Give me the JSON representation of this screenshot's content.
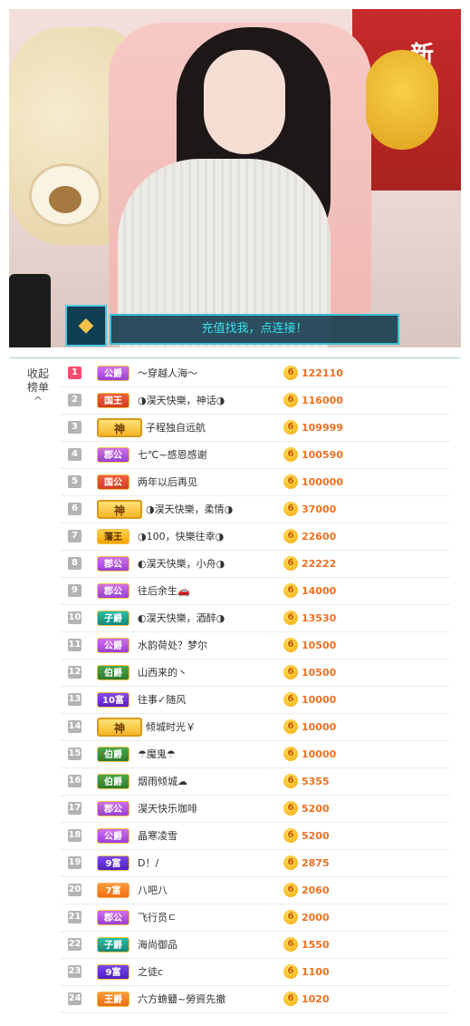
{
  "stream": {
    "banner_text": "充值找我，点连接！",
    "badge_icon": "diamond-icon",
    "background_text": "新"
  },
  "side": {
    "line1": "收起",
    "line2": "榜单",
    "chevron": "^"
  },
  "coin_glyph": "6",
  "leaderboard": [
    {
      "rank": "1",
      "title": "公爵",
      "style": "gong",
      "name": "～穿越人海～",
      "score": "122110"
    },
    {
      "rank": "2",
      "title": "国王",
      "style": "guowang",
      "name": "◑淏天快樂，神话◑",
      "score": "116000"
    },
    {
      "rank": "3",
      "title": "神",
      "style": "shen",
      "name": "子程独自远航",
      "score": "109999"
    },
    {
      "rank": "4",
      "title": "郡公",
      "style": "gong",
      "name": "七℃~感恩感谢",
      "score": "100590"
    },
    {
      "rank": "5",
      "title": "国公",
      "style": "guowang",
      "name": "两年以后再见",
      "score": "100000"
    },
    {
      "rank": "6",
      "title": "神",
      "style": "shen",
      "name": "◑淏天快樂，柔情◑",
      "score": "37000"
    },
    {
      "rank": "7",
      "title": "藩王",
      "style": "fanwang",
      "name": "◑100，快樂往幸◑",
      "score": "22600"
    },
    {
      "rank": "8",
      "title": "郡公",
      "style": "gong",
      "name": "◐淏天快樂，小舟◑",
      "score": "22222"
    },
    {
      "rank": "9",
      "title": "郡公",
      "style": "gong",
      "name": "往后余生🚗",
      "score": "14000"
    },
    {
      "rank": "10",
      "title": "子爵",
      "style": "zijue",
      "name": "◐淏天快樂，酒醉◑",
      "score": "13530"
    },
    {
      "rank": "11",
      "title": "公爵",
      "style": "gong",
      "name": "水韵荷处？梦尔",
      "score": "10500"
    },
    {
      "rank": "12",
      "title": "伯爵",
      "style": "bojue",
      "name": "山西来的丶",
      "score": "10500"
    },
    {
      "rank": "13",
      "title": "10富",
      "style": "fu10",
      "name": "往事✓随风",
      "score": "10000"
    },
    {
      "rank": "14",
      "title": "神",
      "style": "shen",
      "name": "倾城时光￥",
      "score": "10000"
    },
    {
      "rank": "15",
      "title": "伯爵",
      "style": "bojue",
      "name": "☂魔鬼☂",
      "score": "10000"
    },
    {
      "rank": "16",
      "title": "伯爵",
      "style": "bojue",
      "name": "烟雨倾城☁",
      "score": "5355"
    },
    {
      "rank": "17",
      "title": "郡公",
      "style": "gong",
      "name": "淏天快乐咖啡",
      "score": "5200"
    },
    {
      "rank": "18",
      "title": "公爵",
      "style": "gong",
      "name": "晶寒凌雪",
      "score": "5200"
    },
    {
      "rank": "19",
      "title": "9富",
      "style": "fu9",
      "name": "D！/",
      "score": "2875"
    },
    {
      "rank": "20",
      "title": "7富",
      "style": "fu7",
      "name": "八吧八",
      "score": "2060"
    },
    {
      "rank": "21",
      "title": "郡公",
      "style": "gong",
      "name": "飞行员ㄷ",
      "score": "2000"
    },
    {
      "rank": "22",
      "title": "子爵",
      "style": "zijue",
      "name": "海尚御品",
      "score": "1550"
    },
    {
      "rank": "23",
      "title": "9富",
      "style": "fu9",
      "name": "之徒c",
      "score": "1100"
    },
    {
      "rank": "24",
      "title": "王爵",
      "style": "wangjue",
      "name": "六方䗨䀍~勞資先撤",
      "score": "1020"
    }
  ]
}
